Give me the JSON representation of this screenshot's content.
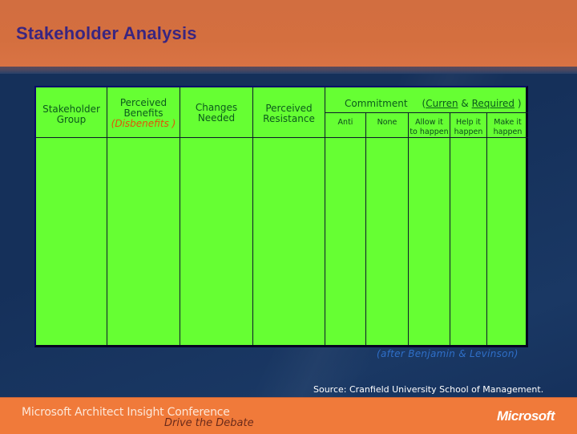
{
  "slide": {
    "title": "Stakeholder Analysis"
  },
  "table": {
    "columns": [
      {
        "lines": [
          "Stakeholder",
          "Group"
        ]
      },
      {
        "lines": [
          "Perceived",
          "Benefits"
        ],
        "note": "(Disbenefits )"
      },
      {
        "lines": [
          "Changes",
          "Needed"
        ]
      },
      {
        "lines": [
          "Perceived",
          "Resistance"
        ]
      }
    ],
    "commitment": {
      "label": "Commitment",
      "paren_open": "(",
      "current": "Curren",
      "amp": " & ",
      "required": "Required",
      "paren_close": " )"
    },
    "commitment_levels": [
      {
        "lines": [
          "Anti"
        ]
      },
      {
        "lines": [
          "None"
        ]
      },
      {
        "lines": [
          "Allow it",
          "to happen"
        ]
      },
      {
        "lines": [
          "Help it",
          "happen"
        ]
      },
      {
        "lines": [
          "Make it",
          "happen"
        ]
      }
    ],
    "colors": {
      "fill": "#66ff33",
      "header_text": "#0b5a1c",
      "disbenefits_text": "#e0520a"
    }
  },
  "attribution": "(after Benjamin & Levinson)",
  "source": "Source:  Cranfield University School of Management.",
  "footer": {
    "conference": "Microsoft Architect Insight Conference",
    "tagline": "Drive the Debate",
    "logo": "Microsoft"
  },
  "theme": {
    "header_orange": "#d46f3f",
    "background_blue": "#15305a",
    "title_color": "#3a2580",
    "footer_orange": "#f07a3a"
  }
}
